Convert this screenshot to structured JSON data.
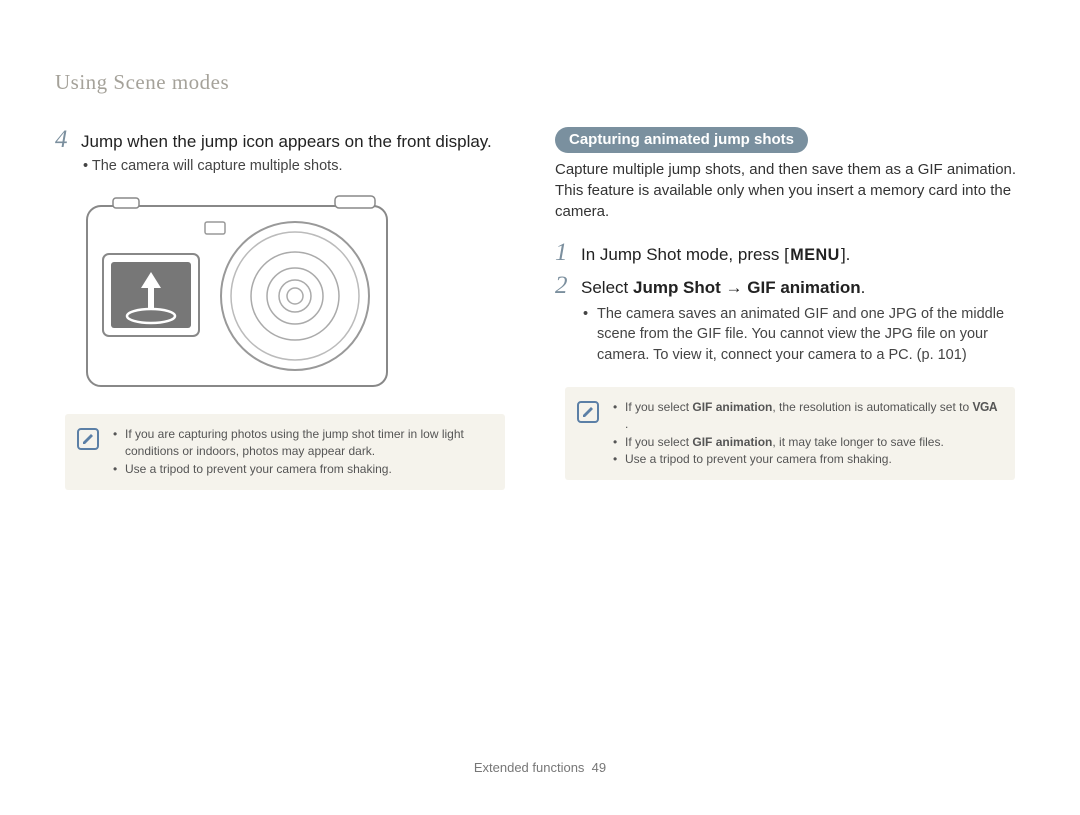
{
  "sectionTitle": "Using Scene modes",
  "left": {
    "step4": {
      "num": "4",
      "text": "Jump when the jump icon appears on the front display.",
      "sub": "The camera will capture multiple shots."
    },
    "note": {
      "items": [
        "If you are capturing photos using the jump shot timer in low light conditions or indoors, photos may appear dark.",
        "Use a tripod to prevent your camera from shaking."
      ]
    }
  },
  "right": {
    "pill": "Capturing animated jump shots",
    "intro": "Capture multiple jump shots, and then save them as a GIF animation. This feature is available only when you insert a memory card into the camera.",
    "step1": {
      "num": "1",
      "prefix": "In Jump Shot mode, press [",
      "menu": "MENU",
      "suffix": "]."
    },
    "step2": {
      "num": "2",
      "prefix": "Select ",
      "boldA": "Jump Shot",
      "arrow": " → ",
      "boldB": "GIF animation",
      "suffix": ".",
      "sub": "The camera saves an animated GIF and one JPG of the middle scene from the GIF file. You cannot view the JPG file on your camera. To view it, connect your camera to a PC. (p. 101)"
    },
    "note": {
      "item1a": "If you select ",
      "item1bold": "GIF animation",
      "item1b": ", the resolution is automatically set to ",
      "item1vga": "VGA",
      "item1c": ".",
      "item2a": "If you select ",
      "item2bold": "GIF animation",
      "item2b": ", it may take longer to save files.",
      "item3": "Use a tripod to prevent your camera from shaking."
    }
  },
  "footer": {
    "label": "Extended functions",
    "page": "49"
  }
}
